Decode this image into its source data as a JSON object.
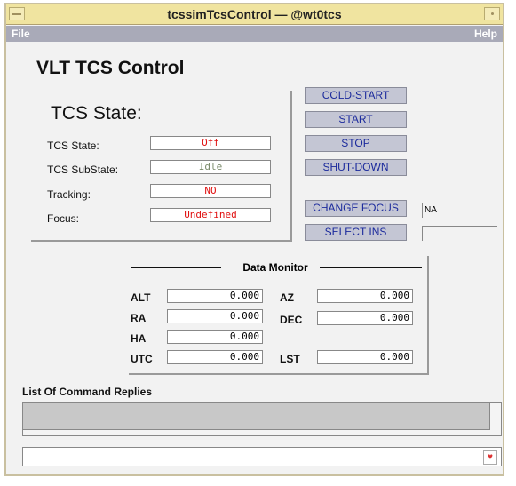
{
  "window": {
    "title": "tcssimTcsControl — @wt0tcs"
  },
  "menubar": {
    "file": "File",
    "help": "Help"
  },
  "app": {
    "title": "VLT TCS Control"
  },
  "state_panel": {
    "heading": "TCS State:",
    "rows": [
      {
        "label": "TCS State:",
        "value": "Off",
        "color": "#e01010"
      },
      {
        "label": "TCS SubState:",
        "value": "Idle",
        "color": "#7a8a6a"
      },
      {
        "label": "Tracking:",
        "value": "NO",
        "color": "#e01010"
      },
      {
        "label": "Focus:",
        "value": "Undefined",
        "color": "#e01010"
      }
    ]
  },
  "buttons": {
    "cold_start": "COLD-START",
    "start": "START",
    "stop": "STOP",
    "shutdown": "SHUT-DOWN",
    "change_focus": "CHANGE FOCUS",
    "select_ins": "SELECT INS"
  },
  "fields": {
    "focus_value": "NA",
    "ins_value": ""
  },
  "data_monitor": {
    "title": "Data Monitor",
    "alt": {
      "label": "ALT",
      "value": "0.000"
    },
    "az": {
      "label": "AZ",
      "value": "0.000"
    },
    "ra": {
      "label": "RA",
      "value": "0.000"
    },
    "dec": {
      "label": "DEC",
      "value": "0.000"
    },
    "ha": {
      "label": "HA",
      "value": "0.000"
    },
    "utc": {
      "label": "UTC",
      "value": "0.000"
    },
    "lst": {
      "label": "LST",
      "value": "0.000"
    }
  },
  "replies": {
    "label": "List Of Command Replies"
  },
  "colors": {
    "button_text": "#1b2a9c",
    "button_bg": "#c4c6d4",
    "menubar_bg": "#a9aab8",
    "titlebar_bg": "#f0e4a0",
    "alert": "#e01010"
  }
}
